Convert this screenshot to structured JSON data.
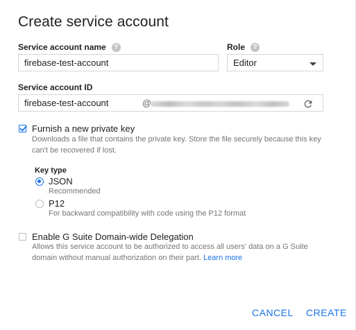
{
  "dialog": {
    "title": "Create service account"
  },
  "service_account_name": {
    "label": "Service account name",
    "value": "firebase-test-account"
  },
  "role": {
    "label": "Role",
    "selected": "Editor"
  },
  "service_account_id": {
    "label": "Service account ID",
    "value": "firebase-test-account",
    "at_sign": "@"
  },
  "private_key": {
    "label": "Furnish a new private key",
    "checked": true,
    "description": "Downloads a file that contains the private key. Store the file securely because this key can't be recovered if lost.",
    "key_type_label": "Key type",
    "options": [
      {
        "label": "JSON",
        "sublabel": "Recommended",
        "selected": true
      },
      {
        "label": "P12",
        "sublabel": "For backward compatibility with code using the P12 format",
        "selected": false
      }
    ]
  },
  "delegation": {
    "label": "Enable G Suite Domain-wide Delegation",
    "checked": false,
    "description": "Allows this service account to be authorized to access all users' data on a G Suite domain without manual authorization on their part.",
    "learn_more": "Learn more"
  },
  "actions": {
    "cancel": "CANCEL",
    "create": "CREATE"
  },
  "colors": {
    "accent": "#1a73e8",
    "help_icon": "#c4c4c4",
    "secondary_text": "#757575"
  },
  "icons": {
    "help": "help-icon",
    "refresh": "refresh-icon",
    "dropdown": "chevron-down-icon"
  }
}
